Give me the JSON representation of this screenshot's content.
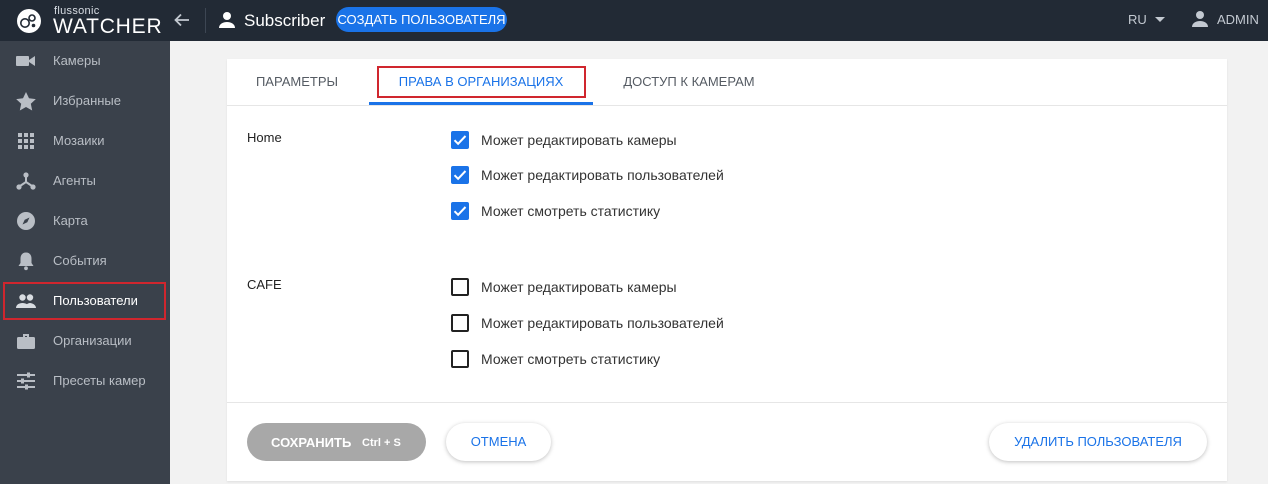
{
  "header": {
    "logo_small": "flussonic",
    "logo_big": "WATCHER",
    "title": "Subscriber",
    "create_button": "СОЗДАТЬ ПОЛЬЗОВАТЕЛЯ",
    "language": "RU",
    "user": "ADMIN"
  },
  "sidebar": {
    "items": [
      {
        "label": "Камеры",
        "icon": "video-camera-icon"
      },
      {
        "label": "Избранные",
        "icon": "star-icon"
      },
      {
        "label": "Мозаики",
        "icon": "grid-icon"
      },
      {
        "label": "Агенты",
        "icon": "network-icon"
      },
      {
        "label": "Карта",
        "icon": "compass-icon"
      },
      {
        "label": "События",
        "icon": "bell-icon"
      },
      {
        "label": "Пользователи",
        "icon": "users-icon",
        "active": true
      },
      {
        "label": "Организации",
        "icon": "briefcase-icon"
      },
      {
        "label": "Пресеты камер",
        "icon": "sliders-icon"
      }
    ]
  },
  "tabs": [
    {
      "label": "ПАРАМЕТРЫ"
    },
    {
      "label": "ПРАВА В ОРГАНИЗАЦИЯХ",
      "active": true
    },
    {
      "label": "ДОСТУП К КАМЕРАМ"
    }
  ],
  "organizations": [
    {
      "name": "Home",
      "permissions": [
        {
          "label": "Может редактировать камеры",
          "checked": true
        },
        {
          "label": "Может редактировать пользователей",
          "checked": true
        },
        {
          "label": "Может смотреть статистику",
          "checked": true
        }
      ]
    },
    {
      "name": "CAFE",
      "permissions": [
        {
          "label": "Может редактировать камеры",
          "checked": false
        },
        {
          "label": "Может редактировать пользователей",
          "checked": false
        },
        {
          "label": "Может смотреть статистику",
          "checked": false
        }
      ]
    }
  ],
  "footer": {
    "save_label": "СОХРАНИТЬ",
    "save_hint": "Ctrl + S",
    "cancel_label": "ОТМЕНА",
    "delete_label": "УДАЛИТЬ ПОЛЬЗОВАТЕЛЯ"
  },
  "colors": {
    "accent": "#1a73e8",
    "topbar": "#222a35",
    "sidebar": "#3a414b",
    "highlight": "#d0262e"
  }
}
